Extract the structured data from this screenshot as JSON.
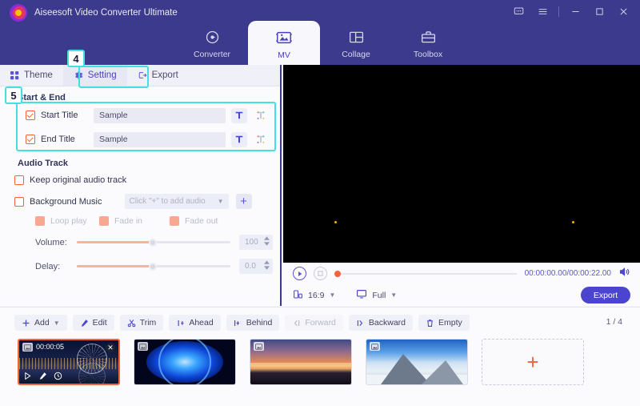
{
  "window": {
    "app_title": "Aiseesoft Video Converter Ultimate",
    "controls": [
      {
        "name": "feedback-icon",
        "label": "feedback"
      },
      {
        "name": "menu-icon",
        "label": "menu"
      },
      {
        "name": "minimize-icon",
        "label": "minimize"
      },
      {
        "name": "maximize-icon",
        "label": "maximize"
      },
      {
        "name": "close-icon",
        "label": "close"
      }
    ]
  },
  "topnav": [
    {
      "label": "Converter",
      "icon": "converter-icon",
      "active": false
    },
    {
      "label": "MV",
      "icon": "mv-icon",
      "active": true
    },
    {
      "label": "Collage",
      "icon": "collage-icon",
      "active": false
    },
    {
      "label": "Toolbox",
      "icon": "toolbox-icon",
      "active": false
    }
  ],
  "tabs": [
    {
      "label": "Theme",
      "icon": "grid-icon",
      "active": false
    },
    {
      "label": "Setting",
      "icon": "gear-icon",
      "active": true
    },
    {
      "label": "Export",
      "icon": "export-icon",
      "active": false
    }
  ],
  "settings": {
    "start_end": {
      "section_label": "Start & End",
      "rows": [
        {
          "label": "Start Title",
          "value": "Sample",
          "checked": true
        },
        {
          "label": "End Title",
          "value": "Sample",
          "checked": true
        }
      ],
      "text_style_icon": "text-style-icon",
      "color_style_icon": "text-color-icon"
    },
    "audio_track": {
      "section_label": "Audio Track",
      "keep_original": {
        "label": "Keep original audio track",
        "checked": false
      },
      "background_music": {
        "label": "Background Music",
        "checked": false,
        "placeholder": "Click \"+\" to add audio"
      },
      "add_button": "+",
      "options": [
        {
          "label": "Loop play",
          "checked": true
        },
        {
          "label": "Fade in",
          "checked": true
        },
        {
          "label": "Fade out",
          "checked": true
        }
      ],
      "volume": {
        "label": "Volume:",
        "value": "100",
        "percent": 50
      },
      "delay": {
        "label": "Delay:",
        "value": "0.0",
        "percent": 50
      }
    }
  },
  "preview": {
    "current_time": "00:00:00.00",
    "total_time": "00:00:22.00",
    "time_display": "00:00:00.00/00:00:22.00",
    "play_icon": "play-icon",
    "stop_icon": "stop-icon",
    "volume_icon": "volume-icon",
    "aspect_ratio": "16:9",
    "zoom_mode": "Full",
    "export_label": "Export"
  },
  "toolbar": [
    {
      "label": "Add",
      "icon": "plus-icon",
      "dropdown": true,
      "disabled": false
    },
    {
      "label": "Edit",
      "icon": "edit-icon",
      "dropdown": false,
      "disabled": false
    },
    {
      "label": "Trim",
      "icon": "scissors-icon",
      "dropdown": false,
      "disabled": false
    },
    {
      "label": "Ahead",
      "icon": "ahead-icon",
      "dropdown": false,
      "disabled": false
    },
    {
      "label": "Behind",
      "icon": "behind-icon",
      "dropdown": false,
      "disabled": false
    },
    {
      "label": "Forward",
      "icon": "forward-icon",
      "dropdown": false,
      "disabled": true
    },
    {
      "label": "Backward",
      "icon": "backward-icon",
      "dropdown": false,
      "disabled": false
    },
    {
      "label": "Empty",
      "icon": "trash-icon",
      "dropdown": false,
      "disabled": false
    }
  ],
  "pagination": "1 / 4",
  "clips": [
    {
      "duration": "00:00:05",
      "selected": true,
      "scene": "city-night"
    },
    {
      "duration": "",
      "selected": false,
      "scene": "blue-flower"
    },
    {
      "duration": "",
      "selected": false,
      "scene": "sunset"
    },
    {
      "duration": "",
      "selected": false,
      "scene": "mountain"
    }
  ],
  "add_tile_label": "+",
  "annotations": [
    {
      "badge": "4",
      "target": "setting-tab"
    },
    {
      "badge": "5",
      "target": "start-end-group"
    }
  ],
  "colors": {
    "header": "#3b3a8c",
    "accent": "#5b54d6",
    "checkbox": "#f4633a",
    "annotation": "#44e0e0",
    "export": "#4a44cf"
  }
}
